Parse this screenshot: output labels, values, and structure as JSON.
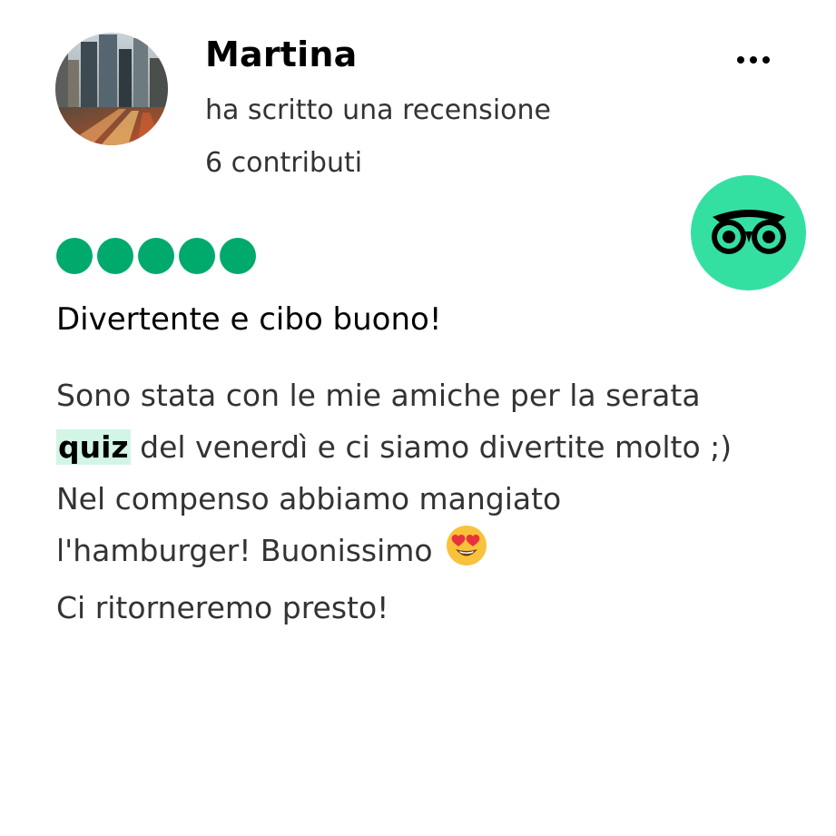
{
  "review": {
    "user_name": "Martina",
    "action_text": "ha scritto una recensione",
    "contributions": "6 contributi",
    "rating_value": 5,
    "rating_max": 5,
    "title": "Divertente e cibo buono!",
    "body": {
      "line1": "Sono stata con le mie amiche per la serata",
      "line2_highlight": "quiz",
      "line2_rest": " del venerdì e ci siamo divertite molto ;)",
      "line3": "Nel compenso abbiamo mangiato",
      "line4": "l'hamburger! Buonissimo ",
      "line5": "Ci ritorneremo presto!"
    }
  },
  "icons": {
    "more": "more-dots-icon",
    "brand_logo": "tripadvisor-owl-icon",
    "emoji": "heart-eyes-emoji-icon"
  },
  "colors": {
    "rating_bubble": "#00aa6c",
    "brand_green": "#34e0a1",
    "highlight_bg": "#d3f5e6"
  }
}
